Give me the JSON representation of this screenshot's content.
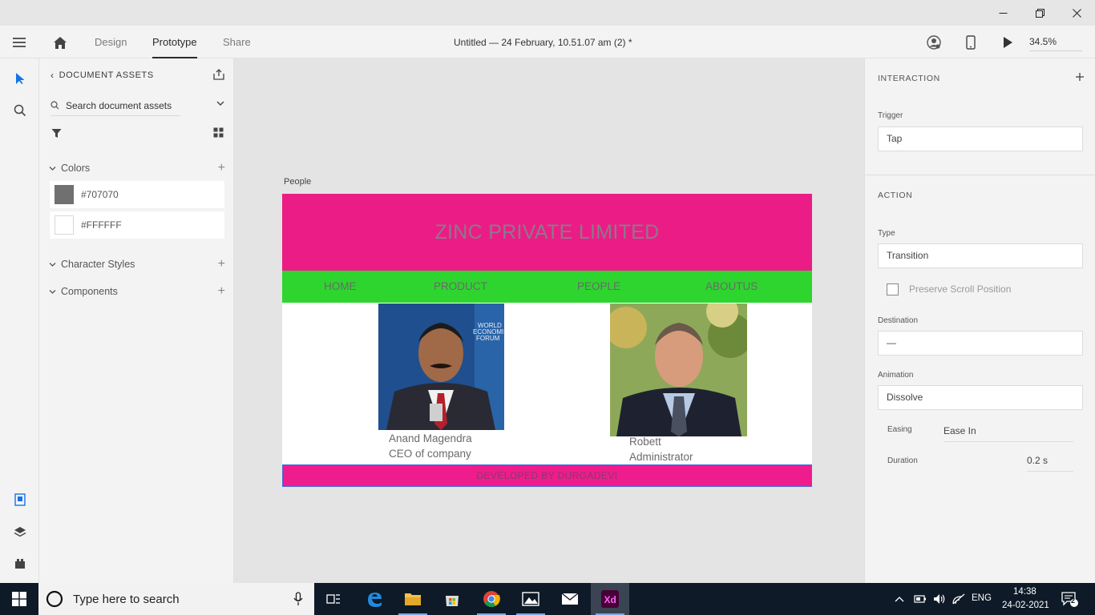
{
  "toolbar": {
    "tabs": [
      {
        "label": "Design"
      },
      {
        "label": "Prototype"
      },
      {
        "label": "Share"
      }
    ],
    "document_title": "Untitled — 24 February, 10.51.07 am (2) *",
    "zoom": "34.5%"
  },
  "assets": {
    "header": "DOCUMENT ASSETS",
    "search_placeholder": "Search document assets",
    "sections": {
      "colors": "Colors",
      "character_styles": "Character Styles",
      "components": "Components"
    },
    "colors": [
      {
        "label": "#707070",
        "hex": "#707070"
      },
      {
        "label": "#FFFFFF",
        "hex": "#FFFFFF"
      }
    ]
  },
  "artboard": {
    "label": "People",
    "header_title": "ZINC PRIVATE LIMITED",
    "header_color": "#EC1C86",
    "nav_color": "#2ED52F",
    "nav": [
      "HOME",
      "PRODUCT",
      "PEOPLE",
      "ABOUTUS"
    ],
    "people": [
      {
        "name": "Anand Magendra",
        "role": "CEO of company"
      },
      {
        "name": "Robett",
        "role": "Administrator"
      }
    ],
    "footer": "DEVELOPED BY DURGADEVI"
  },
  "inspector": {
    "interaction_title": "INTERACTION",
    "trigger_label": "Trigger",
    "trigger_value": "Tap",
    "action_title": "ACTION",
    "type_label": "Type",
    "type_value": "Transition",
    "preserve_scroll": "Preserve Scroll Position",
    "destination_label": "Destination",
    "destination_value": "—",
    "animation_label": "Animation",
    "animation_value": "Dissolve",
    "easing_label": "Easing",
    "easing_value": "Ease In",
    "duration_label": "Duration",
    "duration_value": "0.2 s"
  },
  "taskbar": {
    "search_placeholder": "Type here to search",
    "language": "ENG",
    "time": "14:38",
    "date": "24-02-2021",
    "notification_count": "2"
  }
}
